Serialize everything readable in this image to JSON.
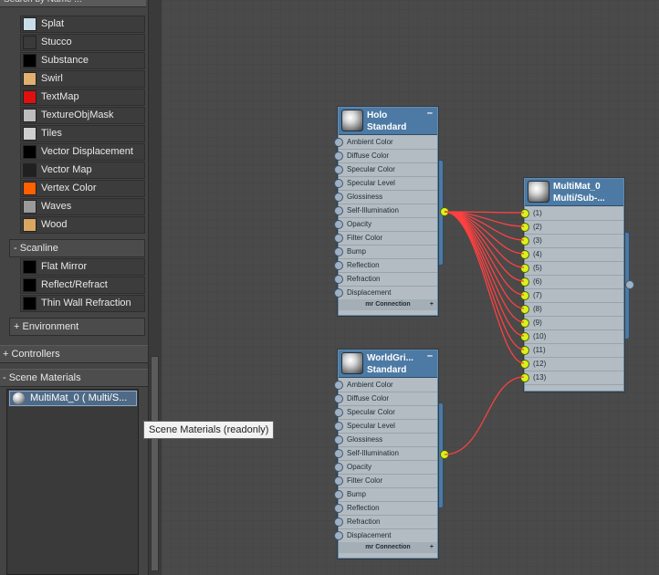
{
  "browser": {
    "search_placeholder": "Search by Name ...",
    "maps": [
      {
        "label": "Splat",
        "swatch": "#c9dde8"
      },
      {
        "label": "Stucco",
        "swatch": "#3a3a3a"
      },
      {
        "label": "Substance",
        "swatch": "#000000"
      },
      {
        "label": "Swirl",
        "swatch": "#e0b070"
      },
      {
        "label": "TextMap",
        "swatch": "#e01010"
      },
      {
        "label": "TextureObjMask",
        "swatch": "#bdbdbd"
      },
      {
        "label": "Tiles",
        "swatch": "#cfcfcf"
      },
      {
        "label": "Vector Displacement",
        "swatch": "#000000"
      },
      {
        "label": "Vector Map",
        "swatch": "#202020"
      },
      {
        "label": "Vertex Color",
        "swatch": "#ff6000"
      },
      {
        "label": "Waves",
        "swatch": "#9a9a9a"
      },
      {
        "label": "Wood",
        "swatch": "#d8a860"
      }
    ],
    "scanline_group": "- Scanline",
    "scanline_items": [
      {
        "label": "Flat Mirror",
        "swatch": "#000000"
      },
      {
        "label": "Reflect/Refract",
        "swatch": "#000000"
      },
      {
        "label": "Thin Wall Refraction",
        "swatch": "#000000"
      }
    ],
    "environment_group": "+ Environment",
    "controllers_section": "+ Controllers",
    "scene_materials_section": "- Scene Materials",
    "scene_item": "MultiMat_0  ( Multi/S...",
    "tooltip": "Scene Materials (readonly)"
  },
  "nodes": {
    "holo": {
      "title": "Holo",
      "subtitle": "Standard",
      "collapse": "–",
      "slots": [
        "Ambient Color",
        "Diffuse Color",
        "Specular Color",
        "Specular Level",
        "Glossiness",
        "Self-Illumination",
        "Opacity",
        "Filter Color",
        "Bump",
        "Reflection",
        "Refraction",
        "Displacement"
      ],
      "footer": "mr Connection",
      "footer_plus": "+"
    },
    "worldgrid": {
      "title": "WorldGri...",
      "subtitle": "Standard",
      "collapse": "–",
      "slots": [
        "Ambient Color",
        "Diffuse Color",
        "Specular Color",
        "Specular Level",
        "Glossiness",
        "Self-Illumination",
        "Opacity",
        "Filter Color",
        "Bump",
        "Reflection",
        "Refraction",
        "Displacement"
      ],
      "footer": "mr Connection",
      "footer_plus": "+"
    },
    "multimat": {
      "title": "MultiMat_0",
      "subtitle": "Multi/Sub-...",
      "slots": [
        "(1)",
        "(2)",
        "(3)",
        "(4)",
        "(5)",
        "(6)",
        "(7)",
        "(8)",
        "(9)",
        "(10)",
        "(11)",
        "(12)",
        "(13)"
      ]
    }
  },
  "colors": {
    "wire": "#ff4040",
    "socket_active": "#d7f21c",
    "node_header": "#4c7aa4"
  }
}
